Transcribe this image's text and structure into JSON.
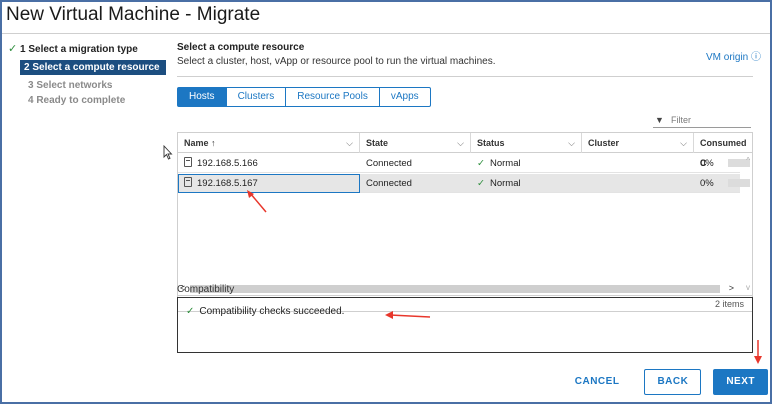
{
  "window": {
    "title": "New Virtual Machine - Migrate"
  },
  "steps": [
    {
      "label": "1 Select a migration type",
      "state": "done"
    },
    {
      "label": "2 Select a compute resource",
      "state": "active"
    },
    {
      "label": "3 Select networks",
      "state": "todo"
    },
    {
      "label": "4 Ready to complete",
      "state": "todo"
    }
  ],
  "section": {
    "title": "Select a compute resource",
    "description": "Select a cluster, host, vApp or resource pool to run the virtual machines.",
    "vm_origin": "VM origin ⓘ"
  },
  "tabs": [
    "Hosts",
    "Clusters",
    "Resource Pools",
    "vApps"
  ],
  "selected_tab": "Hosts",
  "filter": {
    "placeholder": "Filter"
  },
  "grid": {
    "columns": [
      "Name ↑",
      "State",
      "Status",
      "Cluster",
      "Consumed C"
    ],
    "rows": [
      {
        "name": "192.168.5.166",
        "state": "Connected",
        "status": "Normal",
        "cluster": "",
        "consumed": "0%"
      },
      {
        "name": "192.168.5.167",
        "state": "Connected",
        "status": "Normal",
        "cluster": "",
        "consumed": "0%"
      }
    ],
    "footer": "2 items"
  },
  "compatibility": {
    "label": "Compatibility",
    "message": "Compatibility checks succeeded."
  },
  "buttons": {
    "cancel": "CANCEL",
    "back": "BACK",
    "next": "NEXT"
  },
  "colors": {
    "accent": "#1c77c3",
    "annotation": "#e8372c",
    "ok": "#2f8f3e"
  }
}
